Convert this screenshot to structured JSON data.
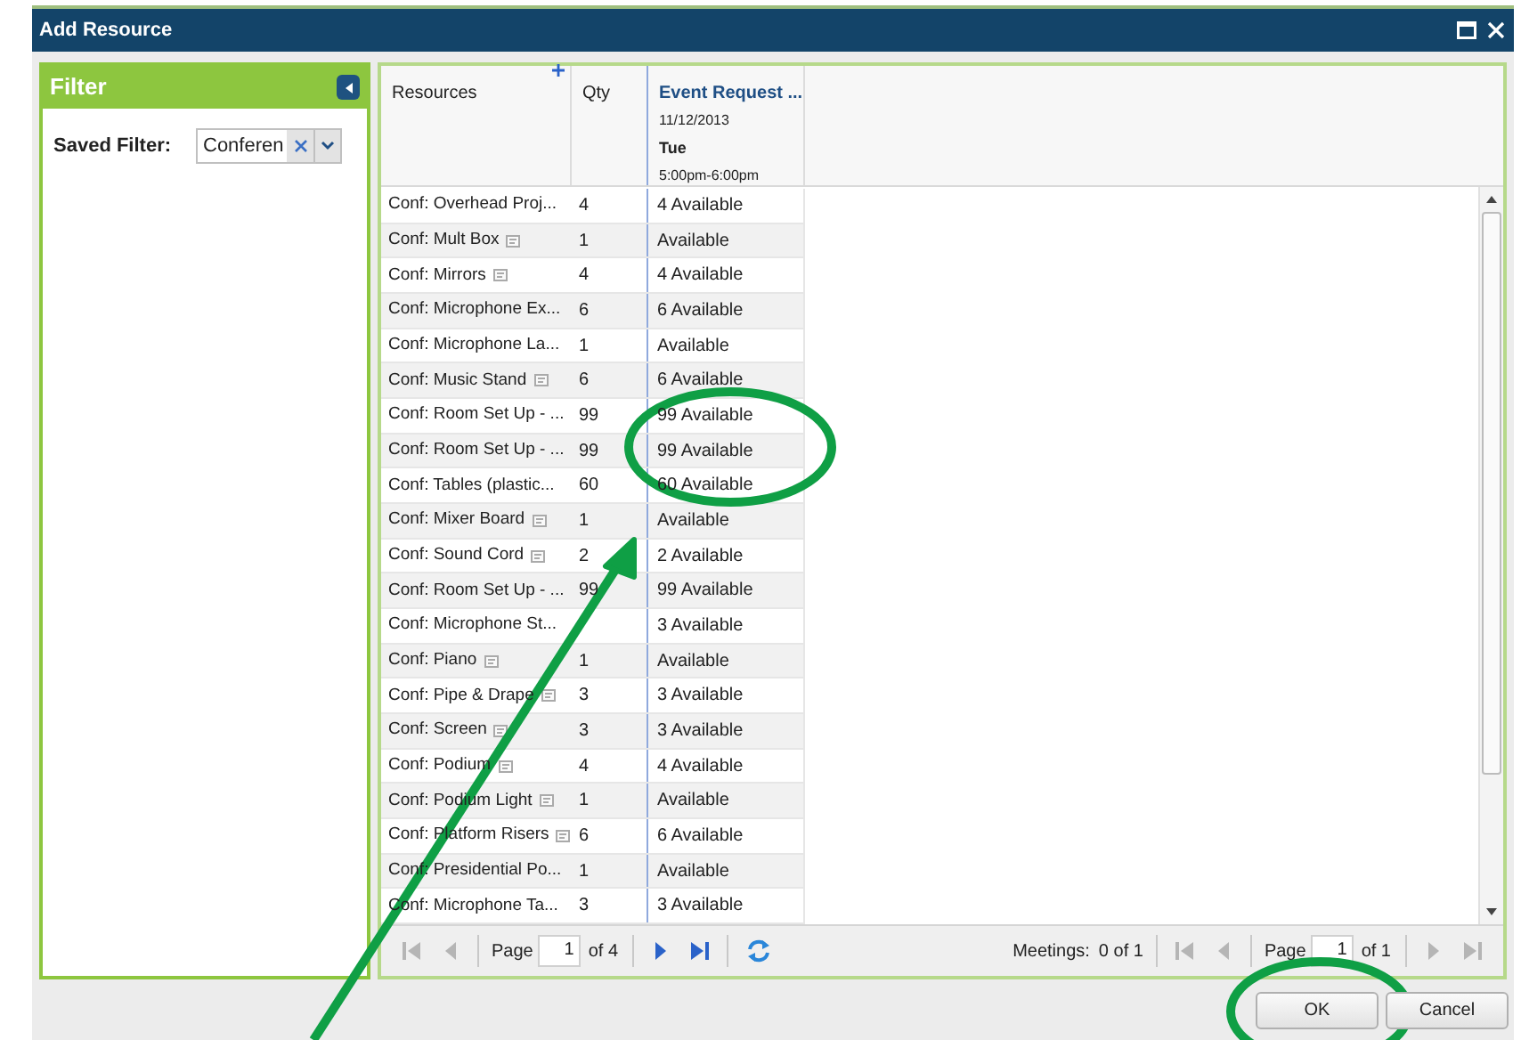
{
  "window": {
    "title": "Add Resource"
  },
  "filter": {
    "title": "Filter",
    "saved_filter_label": "Saved Filter:",
    "saved_filter_value": "Conferen"
  },
  "grid": {
    "columns": [
      {
        "label": "Resources"
      },
      {
        "label": "Qty"
      },
      {
        "label": "Event Request ...",
        "date": "11/12/2013",
        "day": "Tue",
        "time": "5:00pm-6:00pm"
      }
    ],
    "rows": [
      {
        "resource": "Conf: Overhead Proj...",
        "note": false,
        "qty": "4",
        "availability": "4 Available"
      },
      {
        "resource": "Conf: Mult Box",
        "note": true,
        "qty": "1",
        "availability": "Available"
      },
      {
        "resource": "Conf: Mirrors",
        "note": true,
        "qty": "4",
        "availability": "4 Available"
      },
      {
        "resource": "Conf: Microphone Ex...",
        "note": false,
        "qty": "6",
        "availability": "6 Available"
      },
      {
        "resource": "Conf: Microphone La...",
        "note": false,
        "qty": "1",
        "availability": "Available"
      },
      {
        "resource": "Conf: Music Stand",
        "note": true,
        "qty": "6",
        "availability": "6 Available"
      },
      {
        "resource": "Conf: Room Set Up - ...",
        "note": false,
        "qty": "99",
        "availability": "99 Available"
      },
      {
        "resource": "Conf: Room Set Up - ...",
        "note": false,
        "qty": "99",
        "availability": "99 Available"
      },
      {
        "resource": "Conf: Tables (plastic...",
        "note": false,
        "qty": "60",
        "availability": "60 Available"
      },
      {
        "resource": "Conf: Mixer Board",
        "note": true,
        "qty": "1",
        "availability": "Available"
      },
      {
        "resource": "Conf: Sound Cord",
        "note": true,
        "qty": "2",
        "availability": "2 Available"
      },
      {
        "resource": "Conf: Room Set Up - ...",
        "note": false,
        "qty": "99",
        "availability": "99 Available"
      },
      {
        "resource": "Conf: Microphone St...",
        "note": false,
        "availability": "3 Available"
      },
      {
        "resource": "Conf: Piano",
        "note": true,
        "qty": "1",
        "availability": "Available"
      },
      {
        "resource": "Conf: Pipe & Drape",
        "note": true,
        "qty": "3",
        "availability": "3 Available"
      },
      {
        "resource": "Conf: Screen",
        "note": true,
        "qty": "3",
        "availability": "3 Available"
      },
      {
        "resource": "Conf: Podium",
        "note": true,
        "qty": "4",
        "availability": "4 Available"
      },
      {
        "resource": "Conf: Podium Light",
        "note": true,
        "qty": "1",
        "availability": "Available"
      },
      {
        "resource": "Conf: Platform Risers",
        "note": true,
        "qty": "6",
        "availability": "6 Available"
      },
      {
        "resource": "Conf: Presidential Po...",
        "note": false,
        "qty": "1",
        "availability": "Available"
      },
      {
        "resource": "Conf: Microphone Ta...",
        "note": false,
        "qty": "3",
        "availability": "3 Available"
      }
    ]
  },
  "pager": {
    "back": [
      {
        "kind": "first",
        "disabled": true
      },
      {
        "kind": "prev",
        "disabled": true
      }
    ],
    "page_label": "Page",
    "page": "1",
    "total": "of 4",
    "forward": [
      {
        "kind": "next",
        "disabled": false
      },
      {
        "kind": "last",
        "disabled": false
      }
    ]
  },
  "meetings": {
    "label": "Meetings:",
    "count": "0 of 1",
    "back": [
      {
        "kind": "first",
        "disabled": true
      },
      {
        "kind": "prev",
        "disabled": true
      }
    ],
    "page_label": "Page",
    "page": "1",
    "total": "of 1",
    "forward": [
      {
        "kind": "next",
        "disabled": true
      },
      {
        "kind": "last",
        "disabled": true
      }
    ]
  },
  "buttons": [
    {
      "label": "OK"
    },
    {
      "label": "Cancel"
    }
  ]
}
